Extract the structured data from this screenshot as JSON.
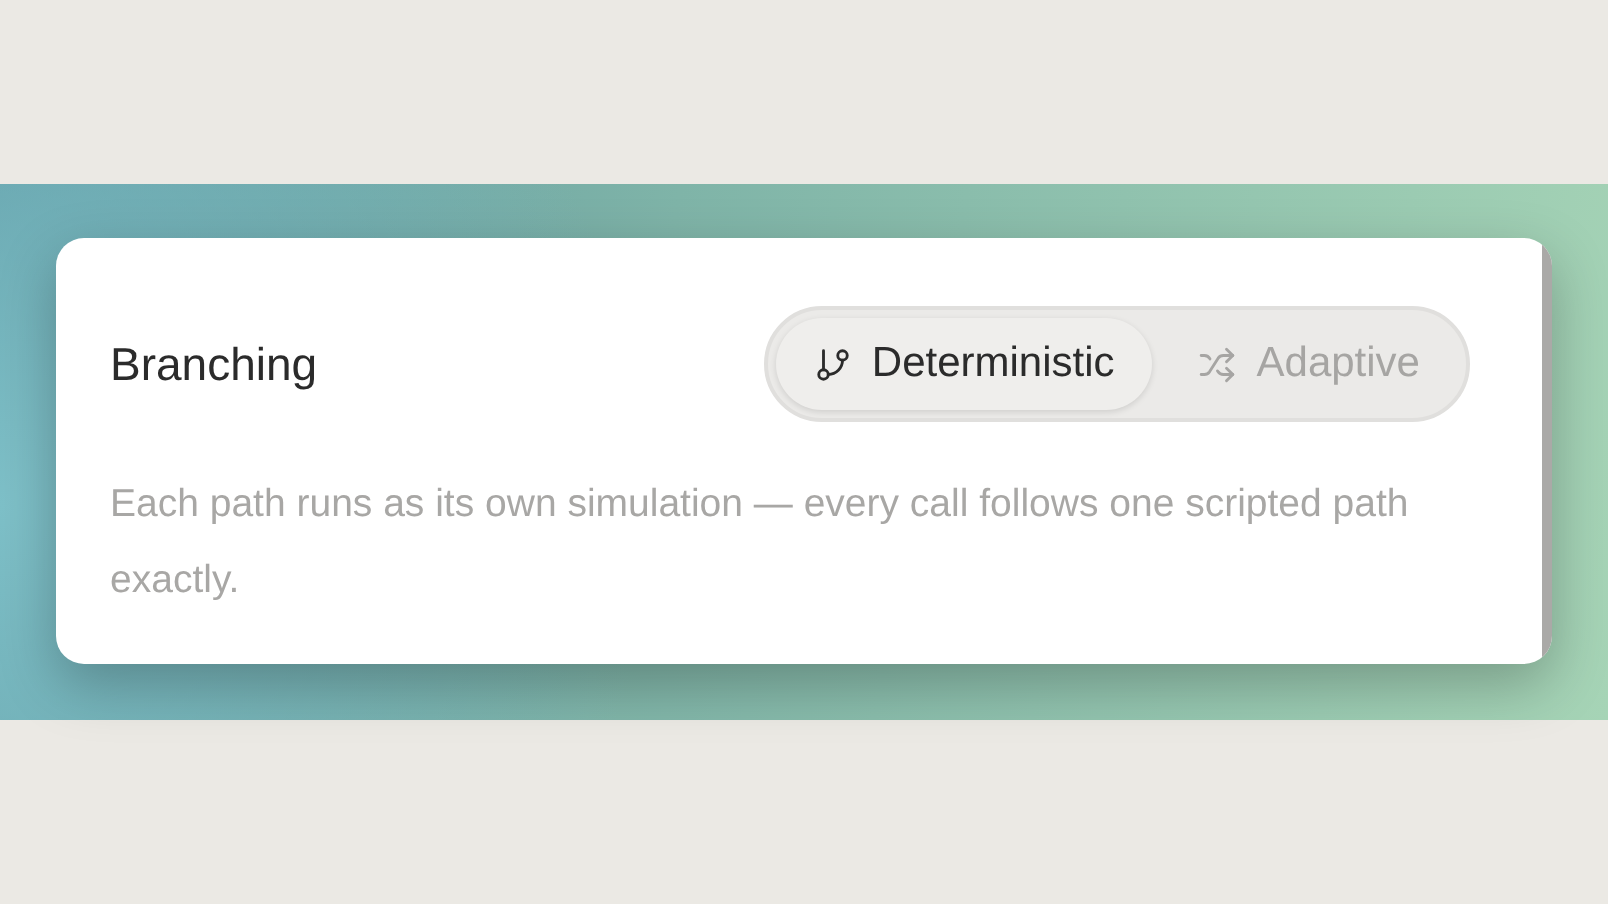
{
  "title": "Branching",
  "modes": [
    {
      "label": "Deterministic",
      "kind": "branch",
      "selected": true
    },
    {
      "label": "Adaptive",
      "kind": "shuffle",
      "selected": false
    }
  ],
  "description": "Each path runs as its own simulation — every call follows one scripted path exactly."
}
